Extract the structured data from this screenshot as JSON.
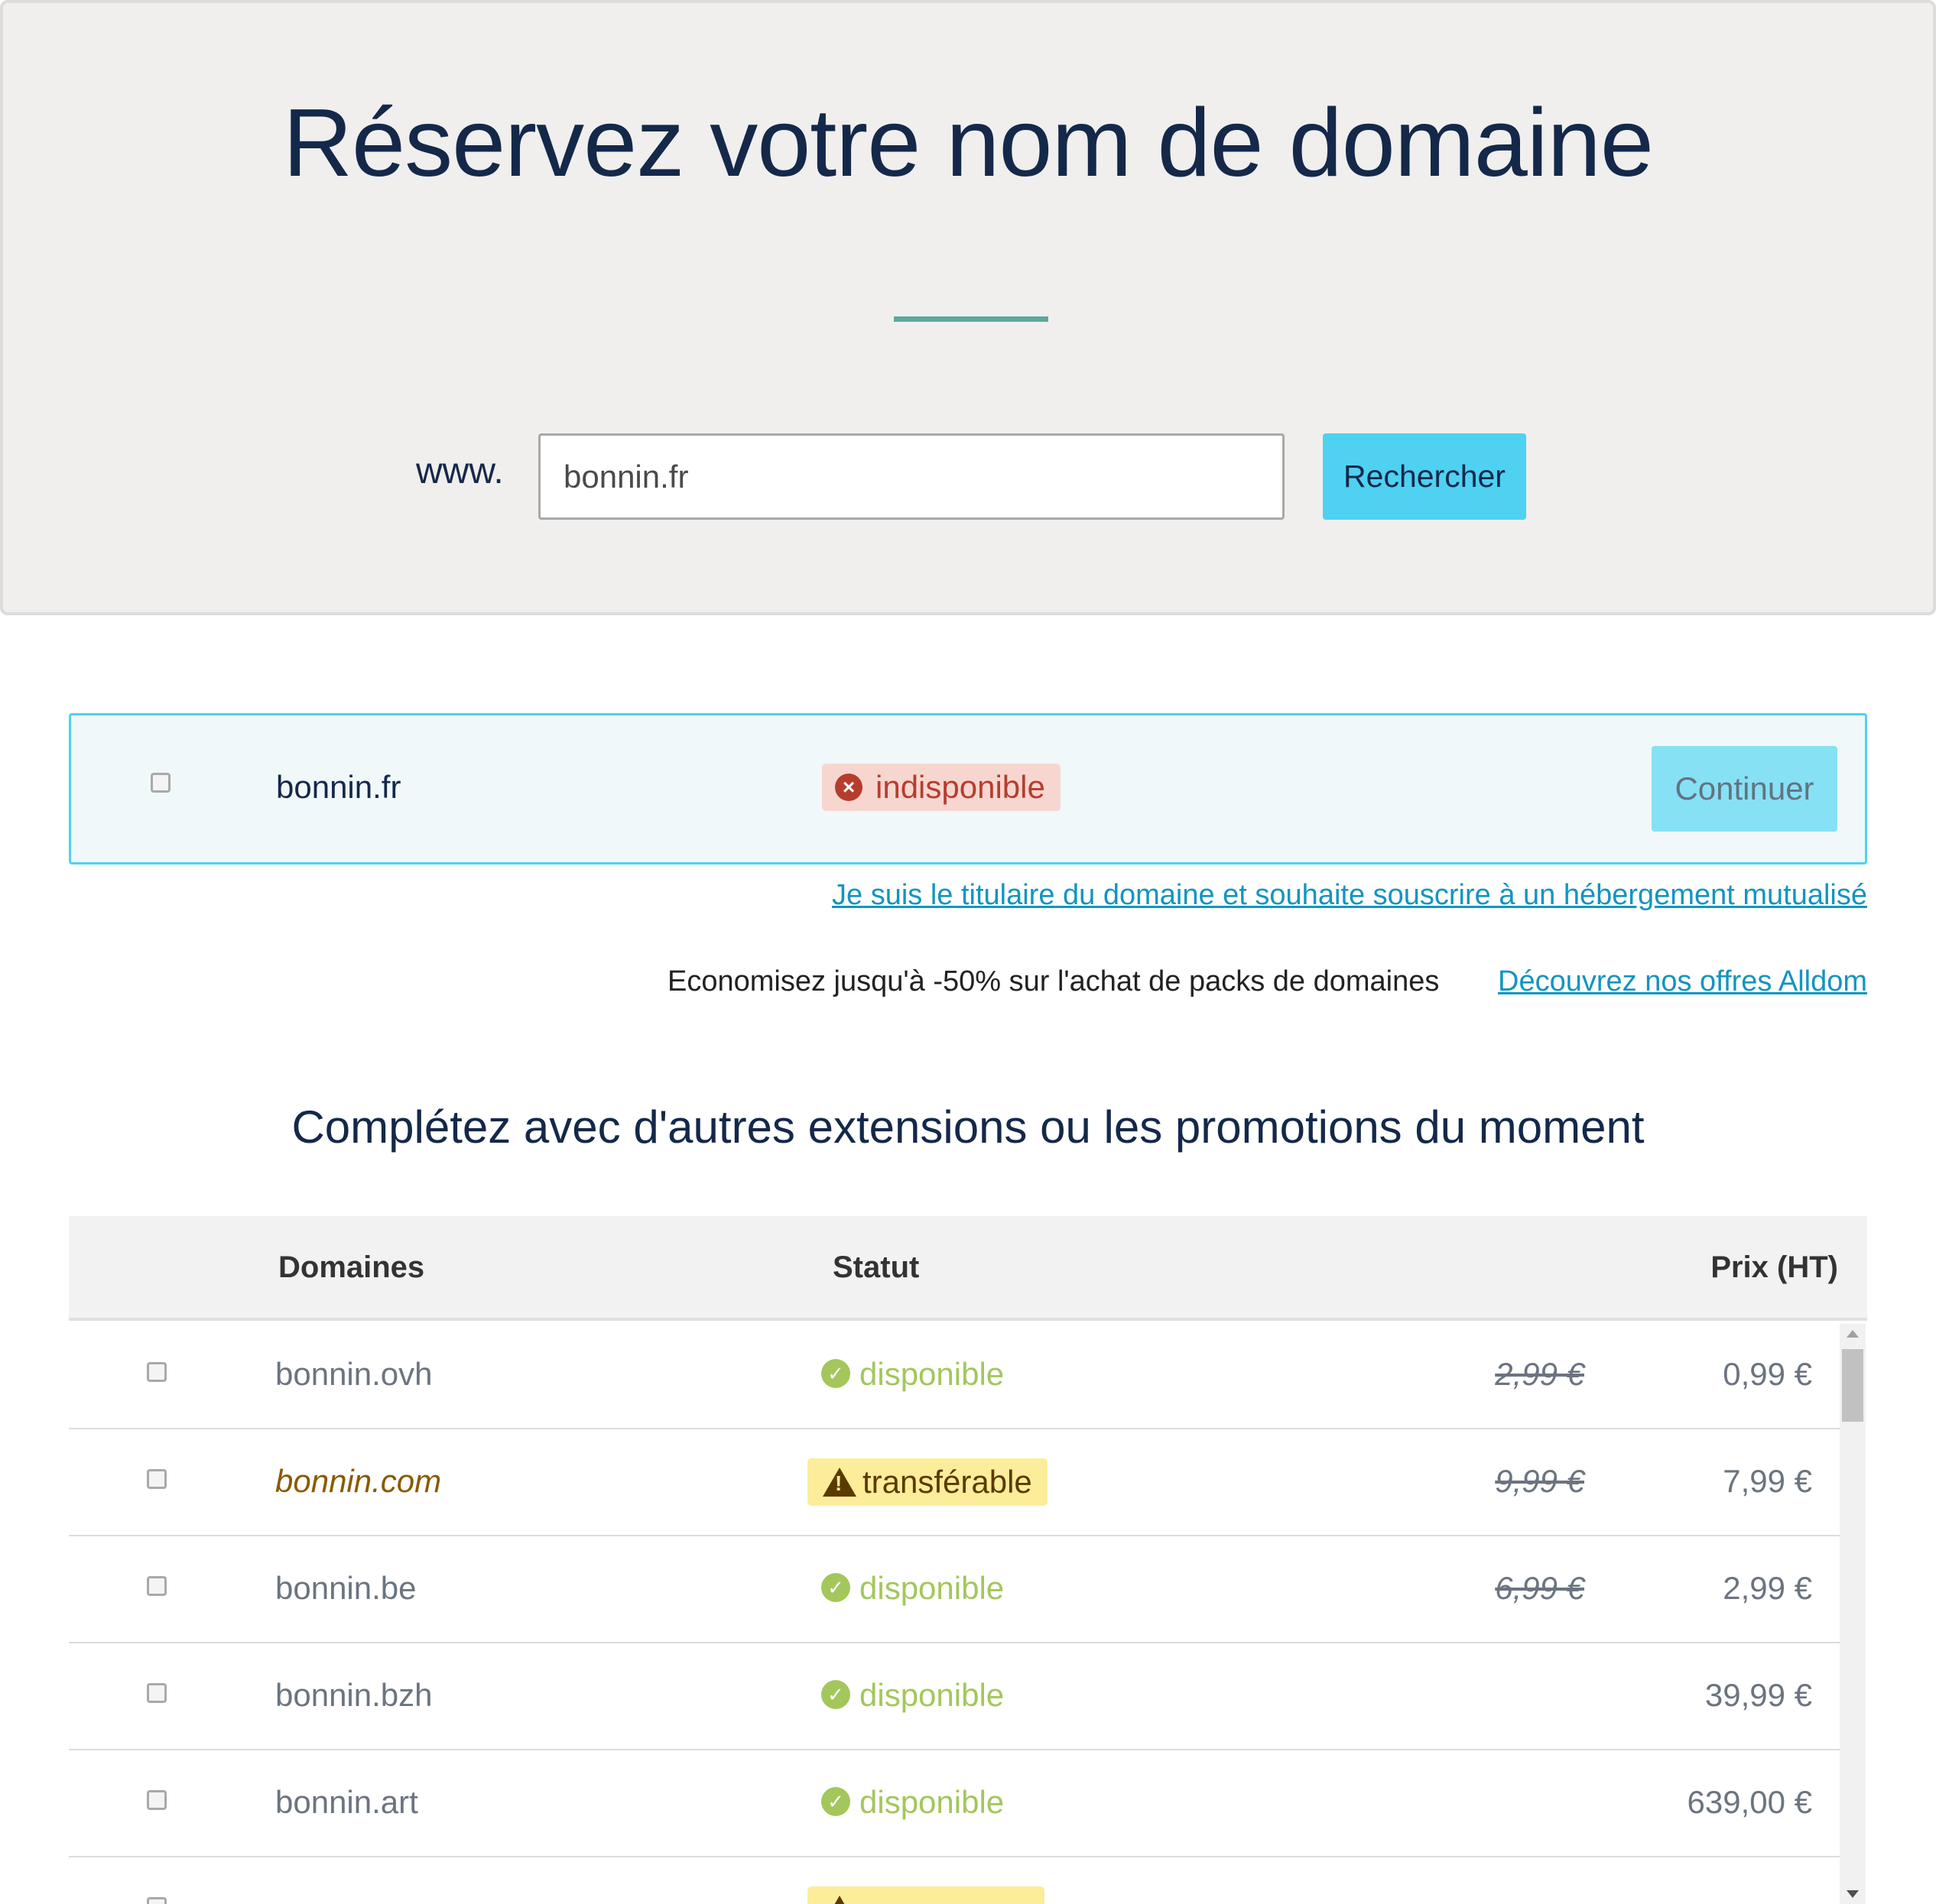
{
  "hero": {
    "title": "Réservez votre nom de domaine",
    "prefix": "www.",
    "search_value": "bonnin.fr",
    "search_button": "Rechercher"
  },
  "main_result": {
    "domain": "bonnin.fr",
    "status": "indisponible",
    "continue_button": "Continuer"
  },
  "owner_link": "Je suis le titulaire du domaine et souhaite souscrire à un hébergement mutualisé",
  "promo": {
    "text": "Economisez jusqu'à -50% sur l'achat de packs de domaines",
    "link": "Découvrez nos offres Alldom"
  },
  "section_heading": "Complétez avec d'autres extensions ou les promotions du moment",
  "table": {
    "headers": {
      "domains": "Domaines",
      "status": "Statut",
      "price": "Prix (HT)"
    },
    "rows": [
      {
        "domain": "bonnin.ovh",
        "status": "disponible",
        "old_price": "2,99 €",
        "price": "0,99 €"
      },
      {
        "domain": "bonnin.com",
        "status": "transférable",
        "old_price": "9,99 €",
        "price": "7,99 €"
      },
      {
        "domain": "bonnin.be",
        "status": "disponible",
        "old_price": "6,99 €",
        "price": "2,99 €"
      },
      {
        "domain": "bonnin.bzh",
        "status": "disponible",
        "old_price": "",
        "price": "39,99 €"
      },
      {
        "domain": "bonnin.art",
        "status": "disponible",
        "old_price": "",
        "price": "639,00 €"
      }
    ]
  },
  "colors": {
    "accent": "#4fd1f1",
    "available": "#a3c75b",
    "unavailable": "#b63d2e",
    "transfer_bg": "#fbed9a",
    "link": "#1295c0"
  }
}
